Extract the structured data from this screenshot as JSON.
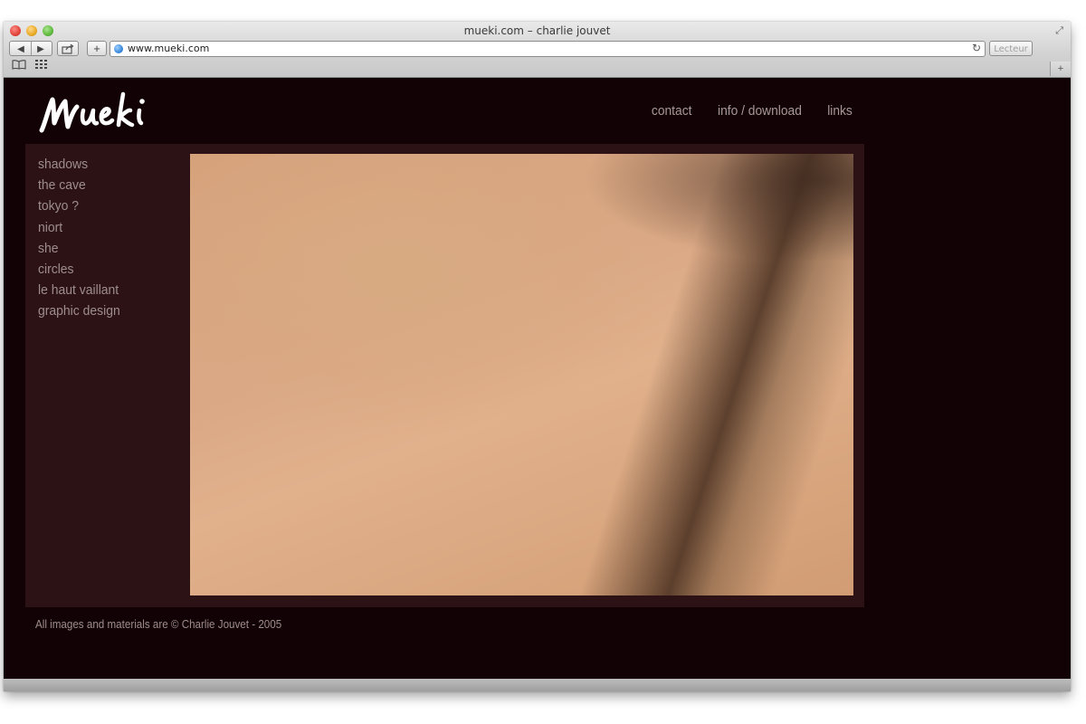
{
  "browser": {
    "window_title": "mueki.com – charlie jouvet",
    "url": "www.mueki.com",
    "reader_label": "Lecteur",
    "back_icon": "◀",
    "forward_icon": "▶",
    "plus_label": "+",
    "new_tab_label": "+"
  },
  "site": {
    "logo_text": "Mueki",
    "top_nav": [
      "contact",
      "info / download",
      "links"
    ],
    "side_menu": [
      "shadows",
      "the cave",
      "tokyo ?",
      "niort",
      "she",
      "circles",
      "le haut vaillant",
      "graphic design"
    ],
    "footer": "All images and materials are © Charlie Jouvet - 2005"
  },
  "colors": {
    "page_bg": "#130205",
    "panel_bg": "#2c1215",
    "text": "#9d8e8c",
    "skin_tone": "#dba986"
  }
}
